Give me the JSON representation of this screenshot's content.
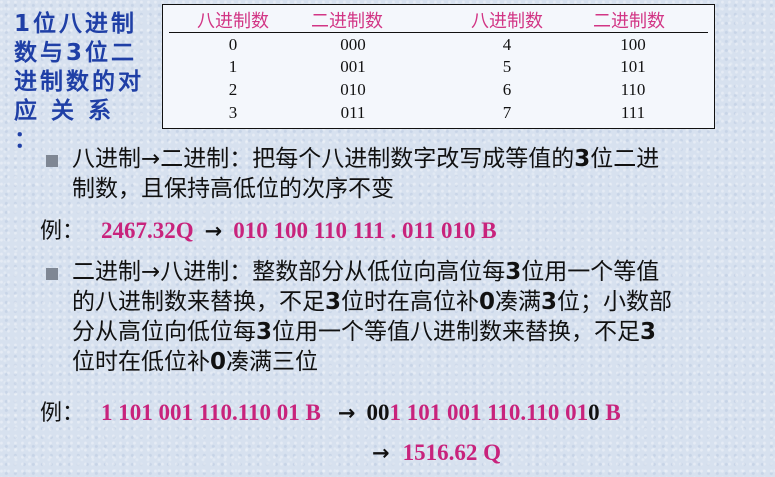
{
  "side_label": "1位八进制\n数与3位二\n进制数的对\n应 关 系 ：",
  "table": {
    "headers": [
      "八进制数",
      "二进制数",
      "八进制数",
      "二进制数"
    ],
    "rows": [
      [
        "0",
        "000",
        "4",
        "100"
      ],
      [
        "1",
        "001",
        "5",
        "101"
      ],
      [
        "2",
        "010",
        "6",
        "110"
      ],
      [
        "3",
        "011",
        "7",
        "111"
      ]
    ]
  },
  "section1": {
    "line1_a": "八进制→二进制：把每个八进制数字改写成等值的",
    "line1_b": "3",
    "line1_c": "位二进",
    "line2": "制数，且保持高低位的次序不变"
  },
  "example1": {
    "label": "例：",
    "from": "2467.32Q",
    "arrow": "→",
    "to": "010 100 110 111 . 011 010 B"
  },
  "section2": {
    "line1_a": "二进制→八进制：整数部分从低位向高位每",
    "line1_b": "3",
    "line1_c": "位用一个等值",
    "line2_a": "的八进制数来替换，不足",
    "line2_b": "3",
    "line2_c": "位时在高位补",
    "line2_d": "0",
    "line2_e": "凑满",
    "line2_f": "3",
    "line2_g": "位；小数部",
    "line3_a": "分从高位向低位每",
    "line3_b": "3",
    "line3_c": "位用一个等值八进制数来替换，不足",
    "line3_d": "3",
    "line4_a": "位时在低位补",
    "line4_b": "0",
    "line4_c": "凑满三位"
  },
  "example2": {
    "label": "例：",
    "from": "1 101 001 110.110 01 B",
    "arrow1": "→",
    "to_pad_left": "00",
    "to_main": "1 101 001 110.110 01",
    "to_pad_right": "0",
    "to_suffix": " B",
    "arrow2": "→",
    "result": "1516.62 Q"
  },
  "colors": {
    "accent": "#c8237c",
    "label_blue": "#1f3fa6",
    "header_pink": "#d23585"
  }
}
